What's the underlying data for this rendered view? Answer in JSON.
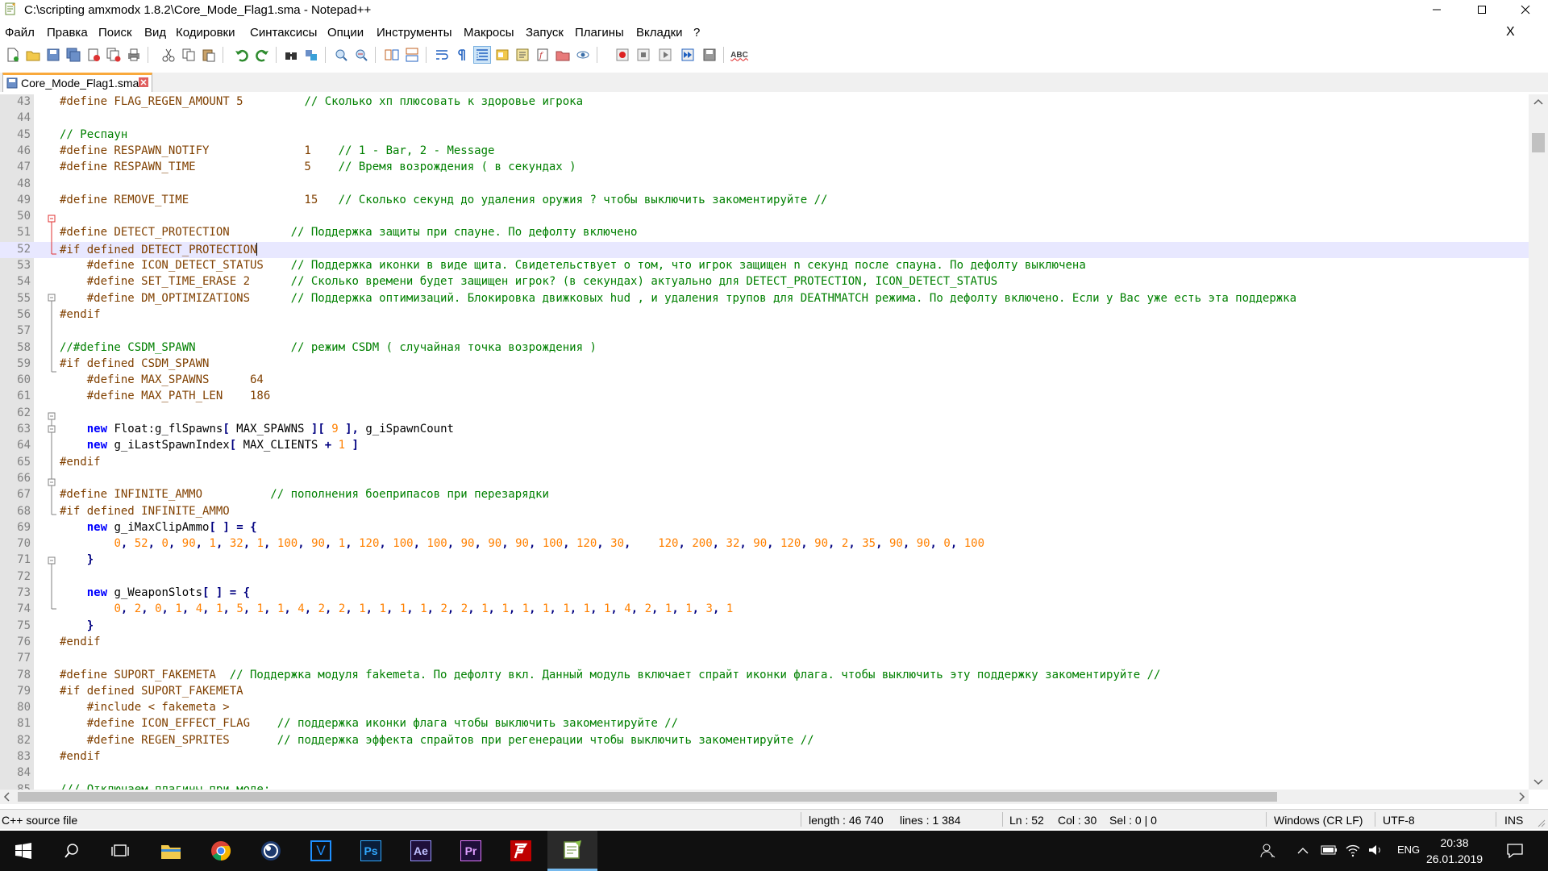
{
  "window": {
    "title": "C:\\scripting amxmodx 1.8.2\\Core_Mode_Flag1.sma - Notepad++",
    "menu_close": "X"
  },
  "menu": [
    "Файл",
    "Правка",
    "Поиск",
    "Вид",
    "Кодировки",
    "Синтаксисы",
    "Опции",
    "Инструменты",
    "Макросы",
    "Запуск",
    "Плагины",
    "Вкладки",
    "?"
  ],
  "toolbar": {
    "icons": [
      "new-file",
      "open-file",
      "save",
      "save-all",
      "close",
      "close-all",
      "print",
      "cut",
      "copy",
      "paste",
      "undo",
      "redo",
      "find",
      "replace",
      "zoom-in",
      "zoom-out",
      "sync-vertical",
      "sync-horizontal",
      "word-wrap",
      "show-all-chars",
      "indent-guide",
      "user-defined-language",
      "doc-map",
      "function-list",
      "folder-as-workspace",
      "monitoring",
      "record-macro",
      "stop-recording",
      "playback-macro",
      "run-macro-multiple",
      "save-macro",
      "spell-check"
    ],
    "spell_label": "ABC"
  },
  "tab": {
    "label": "Core_Mode_Flag1.sma"
  },
  "editor": {
    "current_line": 52,
    "lines": [
      {
        "n": "43",
        "html": "<span class=\"pp\">#define FLAG_REGEN_AMOUNT 5         </span><span class=\"cm\">// Сколько хп плюсовать к здоровье игрока</span>"
      },
      {
        "n": "44",
        "html": ""
      },
      {
        "n": "45",
        "html": "<span class=\"cm\">// Респаун</span>"
      },
      {
        "n": "46",
        "html": "<span class=\"pp\">#define RESPAWN_NOTIFY              1    </span><span class=\"cm\">// 1 - Bar, 2 - Message</span>"
      },
      {
        "n": "47",
        "html": "<span class=\"pp\">#define RESPAWN_TIME                5    </span><span class=\"cm\">// Время возрождения ( в секундах )</span>"
      },
      {
        "n": "48",
        "html": ""
      },
      {
        "n": "49",
        "html": "<span class=\"pp\">#define REMOVE_TIME                 15   </span><span class=\"cm\">// Сколько секунд до удаления оружия ? чтобы выключить закоментируйте //</span>"
      },
      {
        "n": "50",
        "html": ""
      },
      {
        "n": "51",
        "html": "<span class=\"pp\">#define DETECT_PROTECTION         </span><span class=\"cm\">// Поддержка защиты при спауне. По дефолту включено</span>"
      },
      {
        "n": "52",
        "html": "<span class=\"pp\">#if defined DETECT_PROTECTION</span><span class=\"caret\"></span>"
      },
      {
        "n": "53",
        "html": "    <span class=\"pp\">#define ICON_DETECT_STATUS    </span><span class=\"cm\">// Поддержка иконки в виде щита. Свидетельствует о том, что игрок защищен n секунд после спауна. По дефолту выключена</span>"
      },
      {
        "n": "54",
        "html": "    <span class=\"pp\">#define SET_TIME_ERASE 2      </span><span class=\"cm\">// Сколько времени будет защищен игрок? (в секундах) актуально для DETECT_PROTECTION, ICON_DETECT_STATUS</span>"
      },
      {
        "n": "55",
        "html": "    <span class=\"pp\">#define DM_OPTIMIZATIONS      </span><span class=\"cm\">// Поддержка оптимизаций. Блокировка движковых hud , и удаления трупов для DEATHMATCH режима. По дефолту включено. Если у Вас уже есть эта поддержка</span>"
      },
      {
        "n": "56",
        "html": "<span class=\"pp\">#endif</span>"
      },
      {
        "n": "57",
        "html": ""
      },
      {
        "n": "58",
        "html": "<span class=\"cm\">//#define CSDM_SPAWN              // режим CSDM ( случайная точка возрождения )</span>"
      },
      {
        "n": "59",
        "html": "<span class=\"pp\">#if defined CSDM_SPAWN</span>"
      },
      {
        "n": "60",
        "html": "    <span class=\"pp\">#define MAX_SPAWNS      64</span>"
      },
      {
        "n": "61",
        "html": "    <span class=\"pp\">#define MAX_PATH_LEN    186</span>"
      },
      {
        "n": "62",
        "html": ""
      },
      {
        "n": "63",
        "html": "    <span class=\"kw\">new</span> Float:g_flSpawns<span class=\"op\">[</span> MAX_SPAWNS <span class=\"op\">][</span> <span class=\"nb\">9</span> <span class=\"op\">],</span> g_iSpawnCount"
      },
      {
        "n": "64",
        "html": "    <span class=\"kw\">new</span> g_iLastSpawnIndex<span class=\"op\">[</span> MAX_CLIENTS <span class=\"op\">+</span> <span class=\"nb\">1</span> <span class=\"op\">]</span>"
      },
      {
        "n": "65",
        "html": "<span class=\"pp\">#endif</span>"
      },
      {
        "n": "66",
        "html": ""
      },
      {
        "n": "67",
        "html": "<span class=\"pp\">#define INFINITE_AMMO          </span><span class=\"cm\">// пополнения боеприпасов при перезарядки</span>"
      },
      {
        "n": "68",
        "html": "<span class=\"pp\">#if defined INFINITE_AMMO</span>"
      },
      {
        "n": "69",
        "html": "    <span class=\"kw\">new</span> g_iMaxClipAmmo<span class=\"op\">[</span> <span class=\"op\">]</span> <span class=\"op\">=</span> <span class=\"op\">{</span>"
      },
      {
        "n": "70",
        "html": "        <span class=\"nb\">0</span><span class=\"op\">,</span> <span class=\"nb\">52</span><span class=\"op\">,</span> <span class=\"nb\">0</span><span class=\"op\">,</span> <span class=\"nb\">90</span><span class=\"op\">,</span> <span class=\"nb\">1</span><span class=\"op\">,</span> <span class=\"nb\">32</span><span class=\"op\">,</span> <span class=\"nb\">1</span><span class=\"op\">,</span> <span class=\"nb\">100</span><span class=\"op\">,</span> <span class=\"nb\">90</span><span class=\"op\">,</span> <span class=\"nb\">1</span><span class=\"op\">,</span> <span class=\"nb\">120</span><span class=\"op\">,</span> <span class=\"nb\">100</span><span class=\"op\">,</span> <span class=\"nb\">100</span><span class=\"op\">,</span> <span class=\"nb\">90</span><span class=\"op\">,</span> <span class=\"nb\">90</span><span class=\"op\">,</span> <span class=\"nb\">90</span><span class=\"op\">,</span> <span class=\"nb\">100</span><span class=\"op\">,</span> <span class=\"nb\">120</span><span class=\"op\">,</span> <span class=\"nb\">30</span><span class=\"op\">,</span>    <span class=\"nb\">120</span><span class=\"op\">,</span> <span class=\"nb\">200</span><span class=\"op\">,</span> <span class=\"nb\">32</span><span class=\"op\">,</span> <span class=\"nb\">90</span><span class=\"op\">,</span> <span class=\"nb\">120</span><span class=\"op\">,</span> <span class=\"nb\">90</span><span class=\"op\">,</span> <span class=\"nb\">2</span><span class=\"op\">,</span> <span class=\"nb\">35</span><span class=\"op\">,</span> <span class=\"nb\">90</span><span class=\"op\">,</span> <span class=\"nb\">90</span><span class=\"op\">,</span> <span class=\"nb\">0</span><span class=\"op\">,</span> <span class=\"nb\">100</span>"
      },
      {
        "n": "71",
        "html": "    <span class=\"op\">}</span>"
      },
      {
        "n": "72",
        "html": ""
      },
      {
        "n": "73",
        "html": "    <span class=\"kw\">new</span> g_WeaponSlots<span class=\"op\">[</span> <span class=\"op\">]</span> <span class=\"op\">=</span> <span class=\"op\">{</span>"
      },
      {
        "n": "74",
        "html": "        <span class=\"nb\">0</span><span class=\"op\">,</span> <span class=\"nb\">2</span><span class=\"op\">,</span> <span class=\"nb\">0</span><span class=\"op\">,</span> <span class=\"nb\">1</span><span class=\"op\">,</span> <span class=\"nb\">4</span><span class=\"op\">,</span> <span class=\"nb\">1</span><span class=\"op\">,</span> <span class=\"nb\">5</span><span class=\"op\">,</span> <span class=\"nb\">1</span><span class=\"op\">,</span> <span class=\"nb\">1</span><span class=\"op\">,</span> <span class=\"nb\">4</span><span class=\"op\">,</span> <span class=\"nb\">2</span><span class=\"op\">,</span> <span class=\"nb\">2</span><span class=\"op\">,</span> <span class=\"nb\">1</span><span class=\"op\">,</span> <span class=\"nb\">1</span><span class=\"op\">,</span> <span class=\"nb\">1</span><span class=\"op\">,</span> <span class=\"nb\">1</span><span class=\"op\">,</span> <span class=\"nb\">2</span><span class=\"op\">,</span> <span class=\"nb\">2</span><span class=\"op\">,</span> <span class=\"nb\">1</span><span class=\"op\">,</span> <span class=\"nb\">1</span><span class=\"op\">,</span> <span class=\"nb\">1</span><span class=\"op\">,</span> <span class=\"nb\">1</span><span class=\"op\">,</span> <span class=\"nb\">1</span><span class=\"op\">,</span> <span class=\"nb\">1</span><span class=\"op\">,</span> <span class=\"nb\">1</span><span class=\"op\">,</span> <span class=\"nb\">4</span><span class=\"op\">,</span> <span class=\"nb\">2</span><span class=\"op\">,</span> <span class=\"nb\">1</span><span class=\"op\">,</span> <span class=\"nb\">1</span><span class=\"op\">,</span> <span class=\"nb\">3</span><span class=\"op\">,</span> <span class=\"nb\">1</span>"
      },
      {
        "n": "75",
        "html": "    <span class=\"op\">}</span>"
      },
      {
        "n": "76",
        "html": "<span class=\"pp\">#endif</span>"
      },
      {
        "n": "77",
        "html": ""
      },
      {
        "n": "78",
        "html": "<span class=\"pp\">#define SUPORT_FAKEMETA  </span><span class=\"cm\">// Поддержка модуля fakemeta. По дефолту вкл. Данный модуль включает спрайт иконки флага. чтобы выключить эту поддержку закоментируйте //</span>"
      },
      {
        "n": "79",
        "html": "<span class=\"pp\">#if defined SUPORT_FAKEMETA</span>"
      },
      {
        "n": "80",
        "html": "    <span class=\"pp\">#include &lt; fakemeta &gt;</span>"
      },
      {
        "n": "81",
        "html": "    <span class=\"pp\">#define ICON_EFFECT_FLAG    </span><span class=\"cm\">// поддержка иконки флага чтобы выключить закоментируйте //</span>"
      },
      {
        "n": "82",
        "html": "    <span class=\"pp\">#define REGEN_SPRITES       </span><span class=\"cm\">// поддержка эффекта спрайтов при регенерации чтобы выключить закоментируйте //</span>"
      },
      {
        "n": "83",
        "html": "<span class=\"pp\">#endif</span>"
      },
      {
        "n": "84",
        "html": ""
      },
      {
        "n": "85",
        "html": "<span class=\"cm\">/// Отключаем плагины при моде:</span>"
      }
    ]
  },
  "status": {
    "file_type": "C++ source file",
    "length": "length : 46 740",
    "lines": "lines : 1 384",
    "ln": "Ln : 52",
    "col": "Col : 30",
    "sel": "Sel : 0 | 0",
    "eol": "Windows (CR LF)",
    "encoding": "UTF-8",
    "mode": "INS"
  },
  "taskbar": {
    "apps": [
      "file-explorer",
      "chrome",
      "cinema4d",
      "visual-studio",
      "photoshop",
      "after-effects",
      "premiere",
      "filezilla",
      "notepad-plus-plus"
    ],
    "ps_label": "Ps",
    "ae_label": "Ae",
    "pr_label": "Pr",
    "v_label": "V",
    "lang": "ENG",
    "time": "20:38",
    "date": "26.01.2019"
  },
  "colors": {
    "preprocessor": "#804000",
    "comment": "#008000",
    "keyword": "#0000ff",
    "number": "#ff8000",
    "operator": "#000080",
    "current_line": "#e8e8ff",
    "tab_accent": "#f9a93c"
  }
}
